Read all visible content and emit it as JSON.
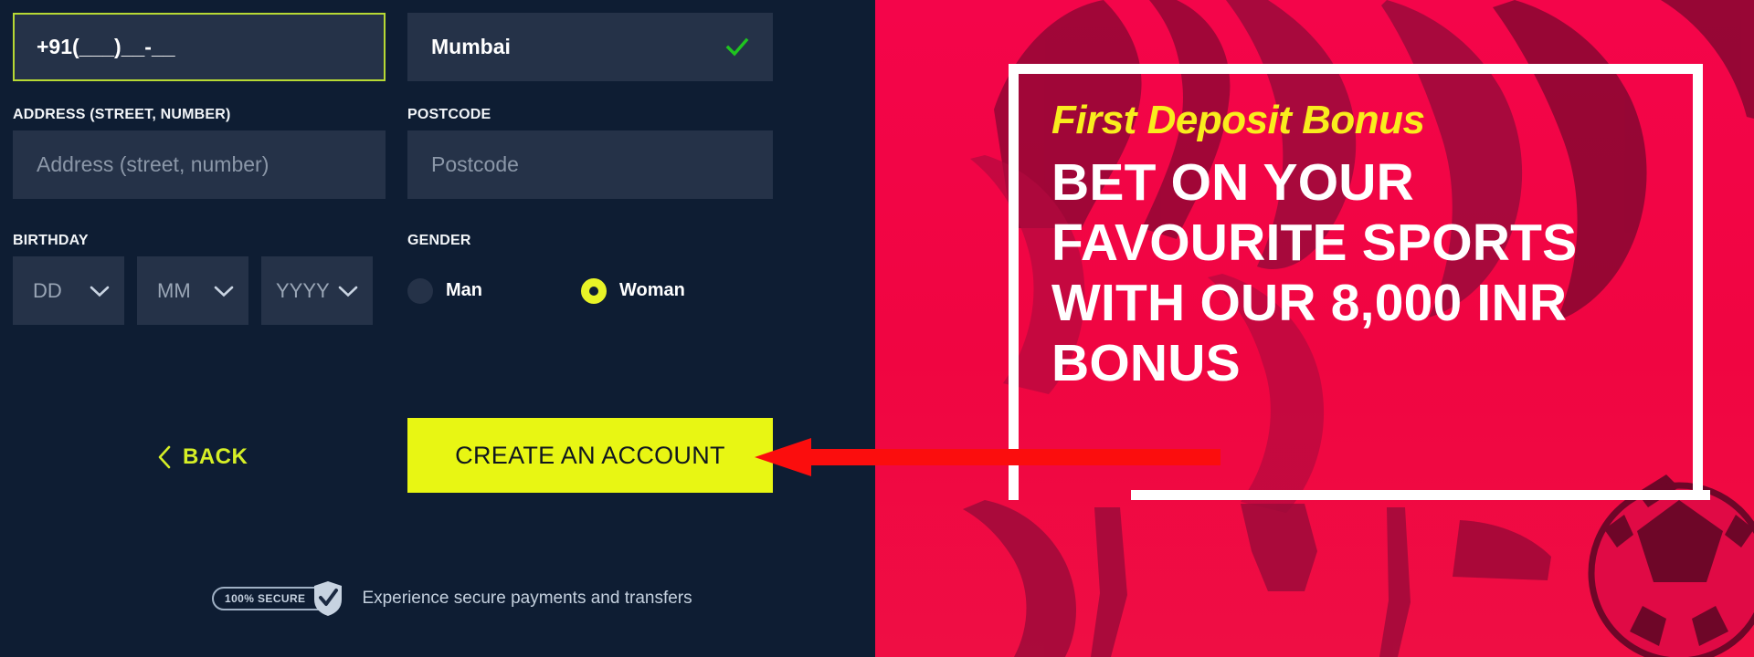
{
  "form": {
    "phone_field": {
      "name": "phone-number-input",
      "value": "+91(___)__-__",
      "focused": true
    },
    "city_field": {
      "name": "city-input",
      "value": "Mumbai",
      "valid_icon": "check-icon"
    },
    "address_field": {
      "label": "ADDRESS (STREET, NUMBER)",
      "placeholder": "Address (street, number)",
      "value": ""
    },
    "postcode_field": {
      "label": "POSTCODE",
      "placeholder": "Postcode",
      "value": ""
    },
    "birthday": {
      "label": "BIRTHDAY",
      "selects": [
        {
          "value": "DD",
          "icon": "chevron-down-icon"
        },
        {
          "value": "MM",
          "icon": "chevron-down-icon"
        },
        {
          "value": "YYYY",
          "icon": "chevron-down-icon"
        }
      ]
    },
    "gender": {
      "label": "GENDER",
      "options": [
        {
          "label": "Man",
          "selected": false
        },
        {
          "label": "Woman",
          "selected": true
        }
      ]
    },
    "actions": {
      "back_label": "BACK",
      "back_icon": "chevron-left-icon",
      "submit_label": "CREATE AN ACCOUNT"
    },
    "secure": {
      "badge_text": "100% SECURE",
      "badge_icon": "shield-check-icon",
      "message": "Experience secure payments and transfers"
    }
  },
  "promo": {
    "kicker": "First Deposit Bonus",
    "headline_line1": "BET ON YOUR",
    "headline_line2": "FAVOURITE SPORTS",
    "headline_line3": "WITH OUR 8,000 INR",
    "headline_line4": "BONUS"
  },
  "annotation": {
    "arrow": "red-arrow-pointing-left",
    "target": "CREATE AN ACCOUNT"
  },
  "colors": {
    "panel_bg": "#0e1d33",
    "input_bg": "#253248",
    "accent_yellow": "#e8f613",
    "accent_lime": "#b7d934",
    "promo_red": "#f00541",
    "valid_green": "#1fc41f",
    "annotation_red": "#fb0d0d"
  }
}
